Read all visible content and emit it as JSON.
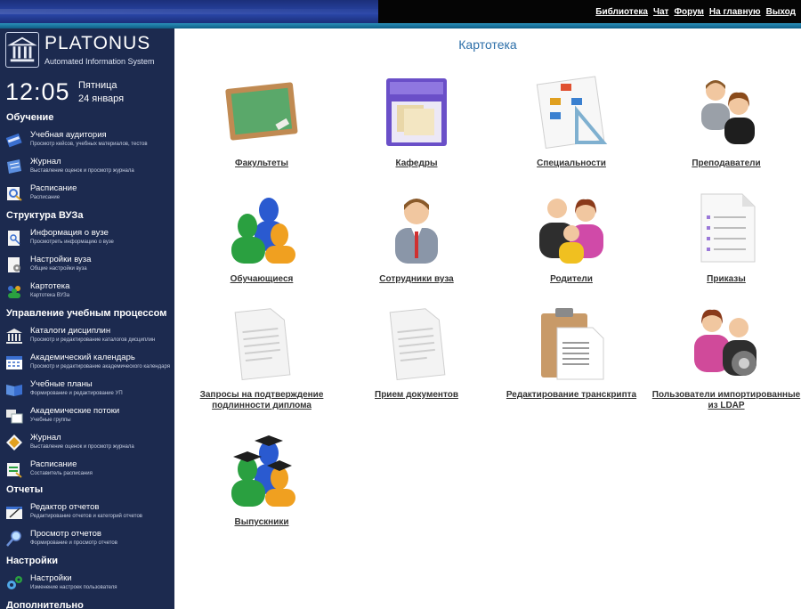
{
  "header": {
    "links": [
      "Библиотека",
      "Чат",
      "Форум",
      "На главную",
      "Выход"
    ]
  },
  "sidebar": {
    "logo_title": "PLATONUS",
    "logo_subtitle": "Automated Information System",
    "clock": "12:05",
    "weekday": "Пятница",
    "date": "24 января",
    "sections": [
      {
        "title": "Обучение",
        "items": [
          {
            "title": "Учебная аудитория",
            "subtitle": "Просмотр кейсов, учебных материалов, тестов"
          },
          {
            "title": "Журнал",
            "subtitle": "Выставление оценок и просмотр журнала"
          },
          {
            "title": "Расписание",
            "subtitle": "Расписание"
          }
        ]
      },
      {
        "title": "Структура ВУЗа",
        "items": [
          {
            "title": "Информация о вузе",
            "subtitle": "Просмотреть информацию о вузе"
          },
          {
            "title": "Настройки вуза",
            "subtitle": "Общие настройки вуза"
          },
          {
            "title": "Картотека",
            "subtitle": "Картотека ВУЗа"
          }
        ]
      },
      {
        "title": "Управление учебным процессом",
        "items": [
          {
            "title": "Каталоги дисциплин",
            "subtitle": "Просмотр и редактирование каталогов дисциплин"
          },
          {
            "title": "Академический календарь",
            "subtitle": "Просмотр и редактирование академического календаря"
          },
          {
            "title": "Учебные планы",
            "subtitle": "Формирование и редактирование УП"
          },
          {
            "title": "Академические потоки",
            "subtitle": "Учебные группы"
          },
          {
            "title": "Журнал",
            "subtitle": "Выставление оценок и просмотр журнала"
          },
          {
            "title": "Расписание",
            "subtitle": "Составитель расписания"
          }
        ]
      },
      {
        "title": "Отчеты",
        "items": [
          {
            "title": "Редактор отчетов",
            "subtitle": "Редактирование отчетов и категорий отчетов"
          },
          {
            "title": "Просмотр отчетов",
            "subtitle": "Формирование и просмотр отчетов"
          }
        ]
      },
      {
        "title": "Настройки",
        "items": [
          {
            "title": "Настройки",
            "subtitle": "Изменение настроек пользователя"
          }
        ]
      },
      {
        "title": "Дополнительно",
        "items": []
      }
    ]
  },
  "main": {
    "title": "Картотека",
    "tiles": [
      {
        "label": "Факультеты",
        "icon": "chalkboard-icon"
      },
      {
        "label": "Кафедры",
        "icon": "file-cabinet-icon"
      },
      {
        "label": "Специальности",
        "icon": "flowchart-icon"
      },
      {
        "label": "Преподаватели",
        "icon": "teachers-icon"
      },
      {
        "label": "Обучающиеся",
        "icon": "students-icon"
      },
      {
        "label": "Сотрудники вуза",
        "icon": "employee-icon"
      },
      {
        "label": "Родители",
        "icon": "parents-icon"
      },
      {
        "label": "Приказы",
        "icon": "document-list-icon"
      },
      {
        "label": "Запросы на подтверждение подлинности диплома",
        "icon": "document-icon"
      },
      {
        "label": "Прием документов",
        "icon": "document-icon"
      },
      {
        "label": "Редактирование транскрипта",
        "icon": "clipboard-icon"
      },
      {
        "label": "Пользователи импортированные из LDAP",
        "icon": "ldap-users-icon"
      },
      {
        "label": "Выпускники",
        "icon": "graduates-icon"
      }
    ]
  },
  "colors": {
    "sidebar_bg": "#1c2a4f",
    "title_blue": "#2b6ea8",
    "top_strip": "#1f7aa3"
  }
}
